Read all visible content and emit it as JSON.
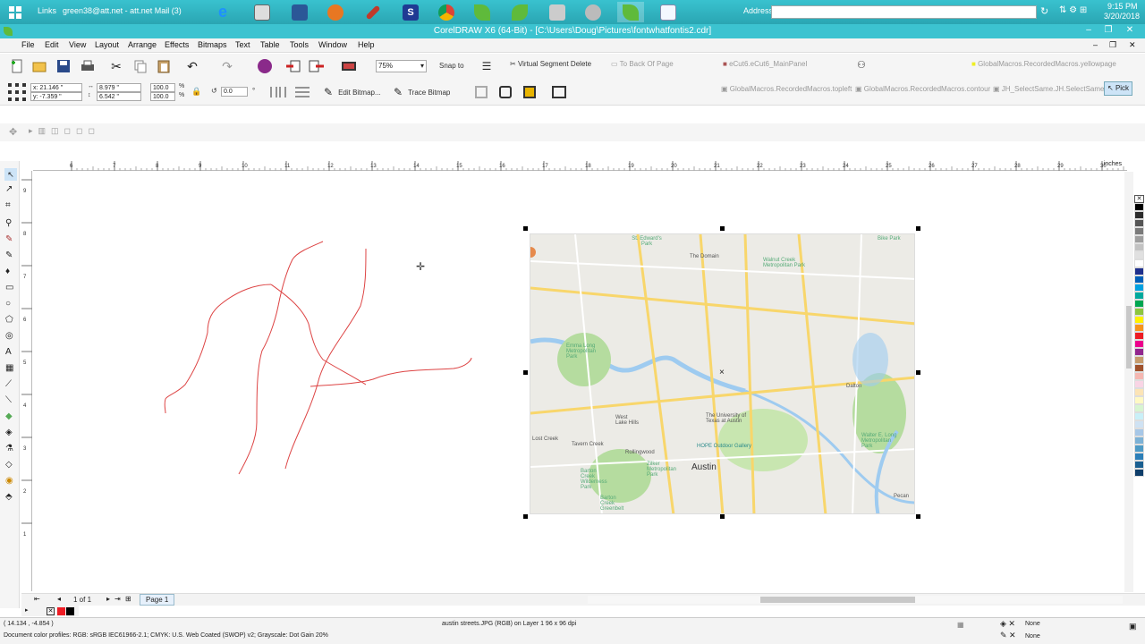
{
  "taskbar": {
    "links_label": "Links",
    "mail_label": "green38@att.net - att.net Mail (3)",
    "address_label": "Address",
    "clock_time": "9:15 PM",
    "clock_date": "3/20/2018",
    "app_icons": [
      "windows-logo",
      "ie",
      "calendar-app",
      "word",
      "paint-app",
      "pen-app",
      "s-app",
      "chrome",
      "corel-leaf",
      "corel-leaf-2",
      "printer",
      "scanner",
      "corel-leaf-active",
      "notepad"
    ]
  },
  "window": {
    "title": "CorelDRAW X6 (64-Bit) - [C:\\Users\\Doug\\Pictures\\fontwhatfontis2.cdr]"
  },
  "menu": {
    "items": [
      "File",
      "Edit",
      "View",
      "Layout",
      "Arrange",
      "Effects",
      "Bitmaps",
      "Text",
      "Table",
      "Tools",
      "Window",
      "Help"
    ]
  },
  "std_toolbar": {
    "zoom": "75%",
    "snap_to": "Snap to",
    "virtual_segment_delete": "Virtual Segment Delete",
    "to_back_of_page": "To Back Of Page",
    "macro_main_panel": "eCut6.eCut6_MainPanel",
    "macro_yellowpage": "GlobalMacros.RecordedMacros.yellowpage"
  },
  "prop_bar": {
    "x": "x: 21.146 \"",
    "y": "y: -7.359 \"",
    "w": "8.979 \"",
    "h": "6.542 \"",
    "scale_x": "100.0",
    "scale_y": "100.0",
    "pct": "%",
    "rotation": "0.0",
    "deg": "°",
    "edit_bitmap": "Edit Bitmap...",
    "trace_bitmap": "Trace Bitmap",
    "macro_topleft": "GlobalMacros.RecordedMacros.topleft",
    "macro_contour": "GlobalMacros.RecordedMacros.contour",
    "macro_select_same": "JH_SelectSame.JH.SelectSame",
    "pick": "Pick"
  },
  "ruler": {
    "ticks": [
      "6",
      "7",
      "8",
      "9",
      "10",
      "11",
      "12",
      "13",
      "14",
      "15",
      "16",
      "17",
      "18",
      "19",
      "20",
      "21",
      "22",
      "23",
      "24",
      "25",
      "26",
      "27",
      "28",
      "29",
      "30"
    ],
    "unit": "inches",
    "v_ticks": [
      "9",
      "8",
      "7",
      "6",
      "5",
      "4",
      "3",
      "2",
      "1"
    ]
  },
  "map": {
    "labels": [
      {
        "t": "St. Edward's Park"
      },
      {
        "t": "The Domain"
      },
      {
        "t": "Walnut Creek Metropolitan Park"
      },
      {
        "t": "Bike Park"
      },
      {
        "t": "Emma Long Metropolitan Park"
      },
      {
        "t": "Dalton"
      },
      {
        "t": "West Lake Hills"
      },
      {
        "t": "Rollingwood"
      },
      {
        "t": "The University of Texas at Austin"
      },
      {
        "t": "HOPE Outdoor Gallery"
      },
      {
        "t": "Austin"
      },
      {
        "t": "Zilker Metropolitan Park"
      },
      {
        "t": "Barton Creek Greenbelt"
      },
      {
        "t": "Walter E. Long Metropolitan Park"
      },
      {
        "t": "Lost Creek"
      },
      {
        "t": "Barton Creek Wilderness Park"
      },
      {
        "t": "Tavern Creek"
      },
      {
        "t": "Pecan"
      }
    ]
  },
  "pagebar": {
    "page_count": "1 of 1",
    "page_tab": "Page 1"
  },
  "status": {
    "coords": "( 14.134 , -4.854 )",
    "object_info": "austin streets.JPG (RGB) on Layer 1 96 x 96 dpi",
    "profiles": "Document color profiles: RGB: sRGB IEC61966-2.1; CMYK: U.S. Web Coated (SWOP) v2; Grayscale: Dot Gain 20%",
    "fill_label": "None",
    "outline_label": "None"
  },
  "palette_colors": [
    "#000000",
    "#2b2b2b",
    "#555555",
    "#7a7a7a",
    "#9e9e9e",
    "#c2c2c2",
    "#e0e0e0",
    "#ffffff",
    "#1e2f8c",
    "#005fb8",
    "#00a0e0",
    "#00a99d",
    "#00a651",
    "#8dc63f",
    "#fff200",
    "#f7941d",
    "#ed1c24",
    "#ec008c",
    "#92278f",
    "#c69c6d",
    "#a0522d",
    "#f5b7b1",
    "#f9d5e5",
    "#fce4b6",
    "#fff9c4",
    "#d7f5d1",
    "#c9f0f8",
    "#cfe2f3",
    "#a7c7e7",
    "#7db2d6",
    "#4f9bc6",
    "#2c7fb8",
    "#1a5f91",
    "#0f3e6a"
  ]
}
